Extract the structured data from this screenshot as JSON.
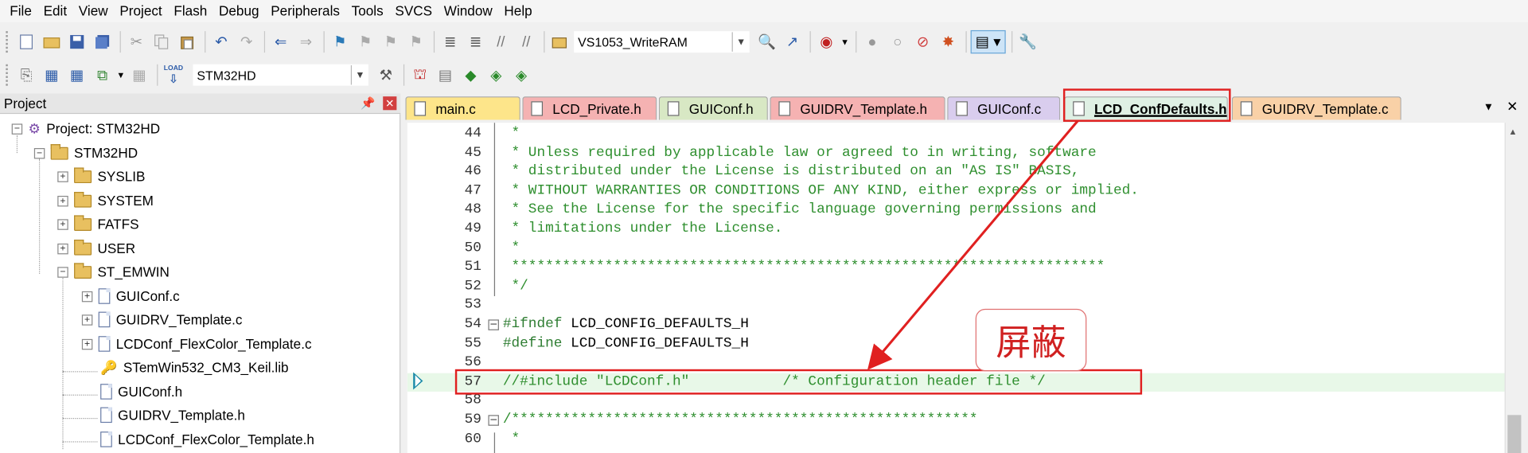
{
  "menu": [
    "File",
    "Edit",
    "View",
    "Project",
    "Flash",
    "Debug",
    "Peripherals",
    "Tools",
    "SVCS",
    "Window",
    "Help"
  ],
  "toolbar1": {
    "target_combo": "VS1053_WriteRAM"
  },
  "toolbar2": {
    "target_combo": "STM32HD",
    "load_label": "LOAD"
  },
  "project_panel": {
    "title": "Project",
    "pin_icon": "pin-icon",
    "close_icon": "close-icon",
    "tree": [
      {
        "label": "Project: STM32HD",
        "icon": "project-icon"
      },
      {
        "label": "STM32HD",
        "icon": "target-icon"
      },
      {
        "label": "SYSLIB",
        "icon": "folder-icon"
      },
      {
        "label": "SYSTEM",
        "icon": "folder-icon"
      },
      {
        "label": "FATFS",
        "icon": "folder-icon"
      },
      {
        "label": "USER",
        "icon": "folder-icon"
      },
      {
        "label": "ST_EMWIN",
        "icon": "folder-open-icon"
      },
      {
        "label": "GUIConf.c",
        "icon": "file-icon"
      },
      {
        "label": "GUIDRV_Template.c",
        "icon": "file-icon"
      },
      {
        "label": "LCDConf_FlexColor_Template.c",
        "icon": "file-icon"
      },
      {
        "label": "STemWin532_CM3_Keil.lib",
        "icon": "library-icon"
      },
      {
        "label": "GUIConf.h",
        "icon": "file-icon"
      },
      {
        "label": "GUIDRV_Template.h",
        "icon": "file-icon"
      },
      {
        "label": "LCDConf_FlexColor_Template.h",
        "icon": "file-icon"
      }
    ]
  },
  "tabs": [
    {
      "label": "main.c",
      "color": "#fde58a"
    },
    {
      "label": "LCD_Private.h",
      "color": "#f5b2b2"
    },
    {
      "label": "GUIConf.h",
      "color": "#d8e8c4"
    },
    {
      "label": "GUIDRV_Template.h",
      "color": "#f5b2b2"
    },
    {
      "label": "GUIConf.c",
      "color": "#d9cdee"
    },
    {
      "label": "LCD_ConfDefaults.h",
      "color": "#dff0e4",
      "active": true
    },
    {
      "label": "GUIDRV_Template.c",
      "color": "#f9d1a7"
    }
  ],
  "code_lines": [
    {
      "num": "44",
      "text": " *",
      "kind": "comment"
    },
    {
      "num": "45",
      "text": " * Unless required by applicable law or agreed to in writing, software",
      "kind": "comment"
    },
    {
      "num": "46",
      "text": " * distributed under the License is distributed on an \"AS IS\" BASIS,",
      "kind": "comment"
    },
    {
      "num": "47",
      "text": " * WITHOUT WARRANTIES OR CONDITIONS OF ANY KIND, either express or implied.",
      "kind": "comment"
    },
    {
      "num": "48",
      "text": " * See the License for the specific language governing permissions and",
      "kind": "comment"
    },
    {
      "num": "49",
      "text": " * limitations under the License.",
      "kind": "comment"
    },
    {
      "num": "50",
      "text": " *",
      "kind": "comment"
    },
    {
      "num": "51",
      "text": " **********************************************************************",
      "kind": "comment"
    },
    {
      "num": "52",
      "text": " */",
      "kind": "comment"
    },
    {
      "num": "53",
      "text": "",
      "kind": "plain"
    },
    {
      "num": "54",
      "text_pre": "#ifndef",
      "text_rest": " LCD_CONFIG_DEFAULTS_H",
      "kind": "pre"
    },
    {
      "num": "55",
      "text_pre": "#define",
      "text_rest": " LCD_CONFIG_DEFAULTS_H",
      "kind": "pre"
    },
    {
      "num": "56",
      "text": "",
      "kind": "plain"
    },
    {
      "num": "57",
      "text": "//#include \"LCDConf.h\"           /* Configuration header file */",
      "kind": "comment"
    },
    {
      "num": "58",
      "text": "",
      "kind": "plain"
    },
    {
      "num": "59",
      "text": "/*******************************************************",
      "kind": "comment"
    },
    {
      "num": "60",
      "text": " *",
      "kind": "comment"
    }
  ],
  "annotation": {
    "label": "屏蔽",
    "color": "#e02020"
  }
}
